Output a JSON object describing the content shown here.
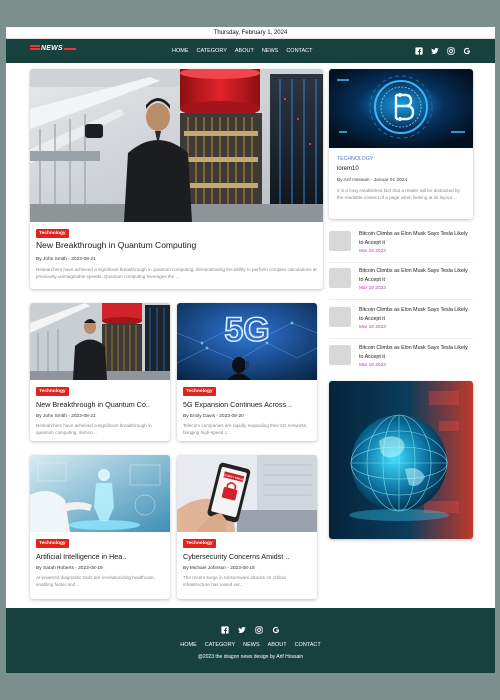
{
  "top_date": "Thursday, February 1, 2024",
  "logo_text": "NEWS",
  "nav": [
    "HOME",
    "CATEGORY",
    "ABOUT",
    "NEWS",
    "CONTACT"
  ],
  "social": [
    "facebook-icon",
    "twitter-icon",
    "instagram-icon",
    "google-icon"
  ],
  "hero": {
    "tag": "Technology",
    "title": "New Breakthrough in Quantum Computing",
    "meta": "By John Smith - 2023-08-21",
    "desc": "Researchers have achieved a significant breakthrough in quantum computing, demonstrating the ability to perform complex calculations at previously unimaginable speeds. Quantum computing leverages the ..."
  },
  "cards": [
    {
      "tag": "Technology",
      "title": "New Breakthrough in Quantum Co..",
      "meta": "By John Smith - 2023-08-21",
      "desc": "Researchers have achieved a significant breakthrough in quantum computing, demon..."
    },
    {
      "tag": "Technology",
      "title": "5G Expansion Continues Across ..",
      "meta": "By Emily Davis - 2023-08-20",
      "desc": "Telecom companies are rapidly expanding their 5G networks, bringing high-speed c..."
    },
    {
      "tag": "Technology",
      "title": "Artificial Intelligence in Hea..",
      "meta": "By Sarah Roberts - 2023-08-19",
      "desc": "AI-powered diagnostic tools are revolutionizing healthcare, enabling faster and ..."
    },
    {
      "tag": "Technology",
      "title": "Cybersecurity Concerns Amidst ..",
      "meta": "By Michael Johnson - 2023-08-18",
      "desc": "The recent surge in ransomware attacks on critical infrastructure has raised ser..."
    }
  ],
  "card_5g_text": "5G",
  "card_padlock_text": "SECURITY BREACH",
  "feature": {
    "category": "TECHNOLOGY",
    "title": "lorem10",
    "meta": "By Arif Hossain - Januar 01 2024",
    "desc": "It is a long established fact that a reader will be distracted by the readable content of a page when looking at its layout ..."
  },
  "side_list": [
    {
      "title": "Bitcoin Climbs as Elon Musk Says Tesla Likely to Accept it",
      "date": "Mar 18 2023"
    },
    {
      "title": "Bitcoin Climbs as Elon Musk Says Tesla Likely to Accept it",
      "date": "Mar 18 2023"
    },
    {
      "title": "Bitcoin Climbs as Elon Musk Says Tesla Likely to Accept it",
      "date": "Mar 18 2023"
    },
    {
      "title": "Bitcoin Climbs as Elon Musk Says Tesla Likely to Accept it",
      "date": "Mar 18 2023"
    }
  ],
  "footer": {
    "menu": [
      "HOME",
      "CATEGORY",
      "NEWS",
      "ABOUT",
      "CONTACT"
    ],
    "copyright": "@2023 the dragon news design by Arif Hossain"
  },
  "colors": {
    "nav_bg": "#17413d",
    "tag_red": "#e2231a",
    "date_purple": "#b43fb1",
    "category_blue": "#4a7fd0"
  }
}
